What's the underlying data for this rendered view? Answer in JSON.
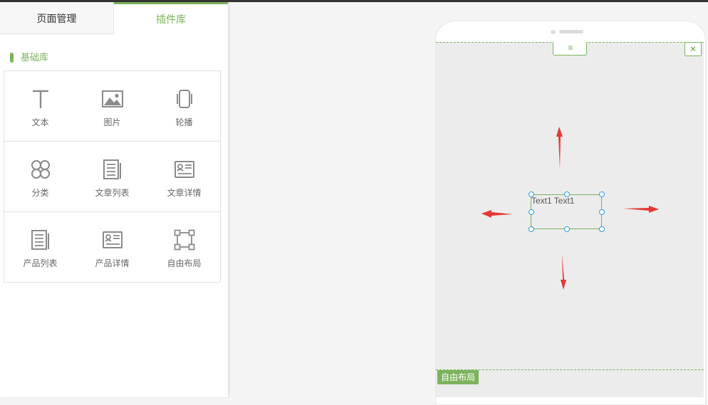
{
  "tabs": {
    "pages_label": "页面管理",
    "plugins_label": "插件库"
  },
  "section": {
    "title": "基础库"
  },
  "widgets": [
    {
      "label": "文本",
      "icon": "text-icon"
    },
    {
      "label": "图片",
      "icon": "image-icon"
    },
    {
      "label": "轮播",
      "icon": "carousel-icon"
    },
    {
      "label": "分类",
      "icon": "category-icon"
    },
    {
      "label": "文章列表",
      "icon": "article-list-icon"
    },
    {
      "label": "文章详情",
      "icon": "article-detail-icon"
    },
    {
      "label": "产品列表",
      "icon": "product-list-icon"
    },
    {
      "label": "产品详情",
      "icon": "product-detail-icon"
    },
    {
      "label": "自由布局",
      "icon": "free-layout-icon"
    }
  ],
  "canvas": {
    "handle_icon": "menu-lines-icon",
    "handle_glyph": "≡",
    "close_glyph": "×",
    "text_element": "Text1 Text1",
    "layout_tag": "自由布局"
  },
  "colors": {
    "accent": "#7cb35b",
    "handle": "#2e9fe0",
    "arrow": "#e53935"
  }
}
